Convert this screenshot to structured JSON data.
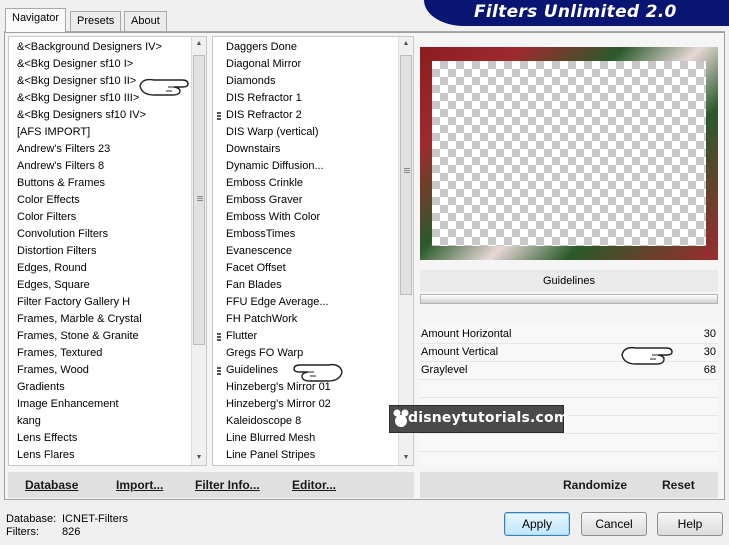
{
  "banner": {
    "title": "Filters Unlimited 2.0"
  },
  "tabs": [
    {
      "label": "Navigator",
      "active": true
    },
    {
      "label": "Presets",
      "active": false
    },
    {
      "label": "About",
      "active": false
    }
  ],
  "categories": [
    "&<Background Designers IV>",
    "&<Bkg Designer sf10 I>",
    "&<Bkg Designer sf10 II>",
    "&<Bkg Designer sf10 III>",
    "&<Bkg Designers sf10 IV>",
    "[AFS IMPORT]",
    "Andrew's Filters 23",
    "Andrew's Filters 8",
    "Buttons & Frames",
    "Color Effects",
    "Color Filters",
    "Convolution Filters",
    "Distortion Filters",
    "Edges, Round",
    "Edges, Square",
    "Filter Factory Gallery H",
    "Frames, Marble & Crystal",
    "Frames, Stone & Granite",
    "Frames, Textured",
    "Frames, Wood",
    "Gradients",
    "Image Enhancement",
    "kang",
    "Lens Effects",
    "Lens Flares"
  ],
  "filters": [
    {
      "label": "Daggers Done",
      "marked": false
    },
    {
      "label": "Diagonal Mirror",
      "marked": false
    },
    {
      "label": "Diamonds",
      "marked": false
    },
    {
      "label": "DIS Refractor 1",
      "marked": false
    },
    {
      "label": "DIS Refractor 2",
      "marked": true
    },
    {
      "label": "DIS Warp (vertical)",
      "marked": false
    },
    {
      "label": "Downstairs",
      "marked": false
    },
    {
      "label": "Dynamic Diffusion...",
      "marked": false
    },
    {
      "label": "Emboss Crinkle",
      "marked": false
    },
    {
      "label": "Emboss Graver",
      "marked": false
    },
    {
      "label": "Emboss With Color",
      "marked": false
    },
    {
      "label": "EmbossTimes",
      "marked": false
    },
    {
      "label": "Evanescence",
      "marked": false
    },
    {
      "label": "Facet Offset",
      "marked": false
    },
    {
      "label": "Fan Blades",
      "marked": false
    },
    {
      "label": "FFU Edge Average...",
      "marked": false
    },
    {
      "label": "FH PatchWork",
      "marked": false
    },
    {
      "label": "Flutter",
      "marked": true
    },
    {
      "label": "Gregs FO Warp",
      "marked": false
    },
    {
      "label": "Guidelines",
      "marked": true
    },
    {
      "label": "Hinzeberg's Mirror 01",
      "marked": false
    },
    {
      "label": "Hinzeberg's Mirror 02",
      "marked": false
    },
    {
      "label": "Kaleidoscope 8",
      "marked": false
    },
    {
      "label": "Line Blurred Mesh",
      "marked": false
    },
    {
      "label": "Line Panel Stripes",
      "marked": false
    }
  ],
  "selected_filter": "Guidelines",
  "params": [
    {
      "label": "Amount Horizontal",
      "value": "30"
    },
    {
      "label": "Amount Vertical",
      "value": "30"
    },
    {
      "label": "Graylevel",
      "value": "68"
    }
  ],
  "toolbar": {
    "database": "Database",
    "import": "Import...",
    "filter_info": "Filter Info...",
    "editor": "Editor...",
    "randomize": "Randomize",
    "reset": "Reset"
  },
  "status": {
    "database_label": "Database:",
    "database_value": "ICNET-Filters",
    "filters_label": "Filters:",
    "filters_value": "826"
  },
  "buttons": {
    "apply": "Apply",
    "cancel": "Cancel",
    "help": "Help"
  },
  "watermark": "disneytutorials.com",
  "colors": {
    "banner": "#081573",
    "preview_red": "#8c1c20",
    "preview_green": "#2a5a2a"
  }
}
